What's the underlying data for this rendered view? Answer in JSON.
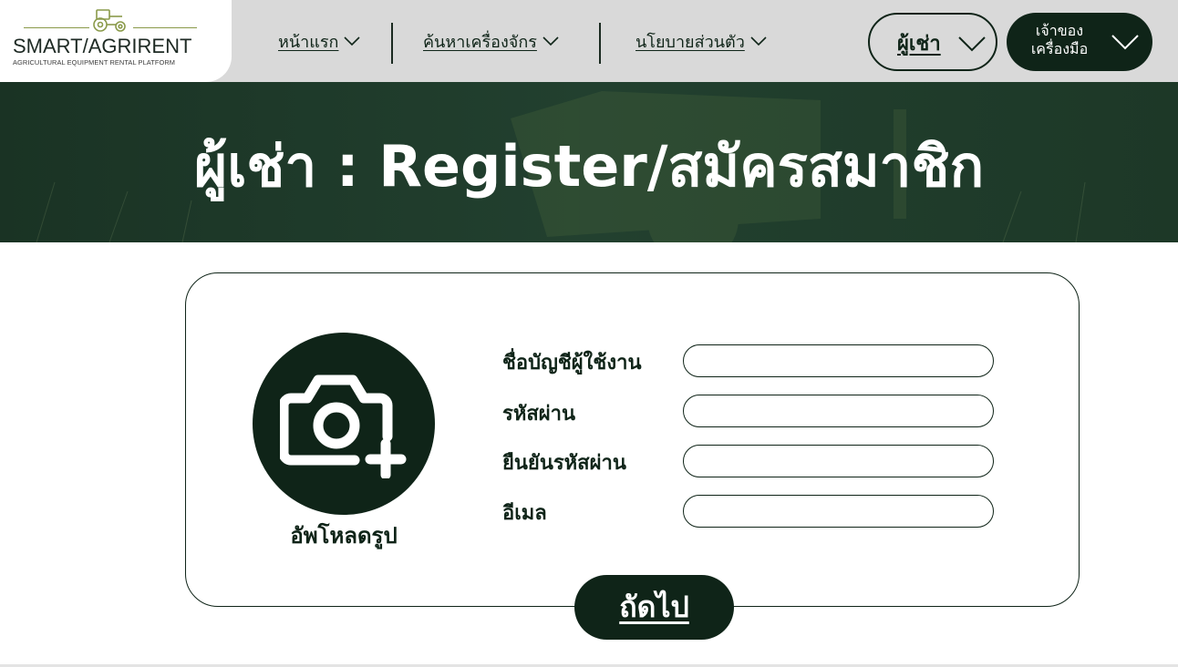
{
  "brand": {
    "name": "SMART/AGRIRENT",
    "tagline": "AGRICULTURAL EQUIPMENT RENTAL PLATFORM"
  },
  "nav": {
    "items": [
      {
        "label": "หน้าแรก"
      },
      {
        "label": "ค้นหาเครื่องจักร"
      },
      {
        "label": "นโยบายส่วนตัว"
      }
    ],
    "renter_label": "ผู้เช่า",
    "owner_label": "เจ้าของ เครื่องมือ"
  },
  "hero": {
    "title": "ผู้เช่า : Register/สมัครสมาชิก"
  },
  "form": {
    "upload_label": "อัพโหลดรูป",
    "fields": [
      {
        "label": "ชื่อบัญชีผู้ใช้งาน",
        "value": ""
      },
      {
        "label": "รหัสผ่าน",
        "value": ""
      },
      {
        "label": "ยืนยันรหัสผ่าน",
        "value": ""
      },
      {
        "label": "อีเมล",
        "value": ""
      }
    ],
    "next_label": "ถัดไป"
  },
  "colors": {
    "primary_dark_green": "#0f2418",
    "nav_bg": "#d9d9d9",
    "hero_bg": "#1f3a2b",
    "logo_accent": "#8a9a4a"
  },
  "icons": [
    "tractor-logo-icon",
    "chevron-down-icon",
    "camera-plus-icon"
  ]
}
